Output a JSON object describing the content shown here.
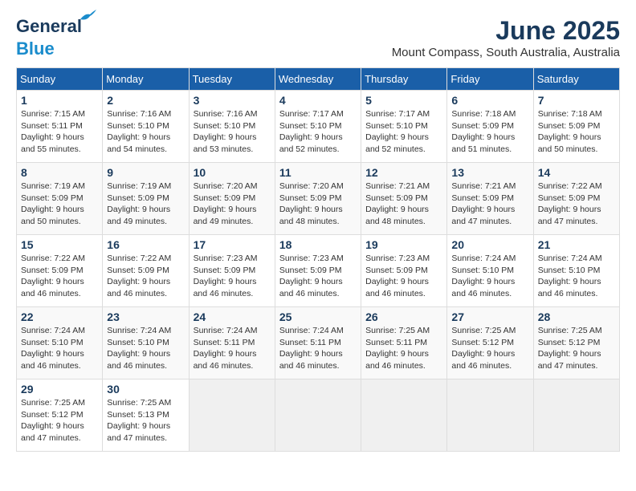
{
  "header": {
    "logo_line1": "General",
    "logo_line2": "Blue",
    "month": "June 2025",
    "location": "Mount Compass, South Australia, Australia"
  },
  "weekdays": [
    "Sunday",
    "Monday",
    "Tuesday",
    "Wednesday",
    "Thursday",
    "Friday",
    "Saturday"
  ],
  "weeks": [
    [
      {
        "day": "1",
        "sunrise": "7:15 AM",
        "sunset": "5:11 PM",
        "daylight": "9 hours and 55 minutes."
      },
      {
        "day": "2",
        "sunrise": "7:16 AM",
        "sunset": "5:10 PM",
        "daylight": "9 hours and 54 minutes."
      },
      {
        "day": "3",
        "sunrise": "7:16 AM",
        "sunset": "5:10 PM",
        "daylight": "9 hours and 53 minutes."
      },
      {
        "day": "4",
        "sunrise": "7:17 AM",
        "sunset": "5:10 PM",
        "daylight": "9 hours and 52 minutes."
      },
      {
        "day": "5",
        "sunrise": "7:17 AM",
        "sunset": "5:10 PM",
        "daylight": "9 hours and 52 minutes."
      },
      {
        "day": "6",
        "sunrise": "7:18 AM",
        "sunset": "5:09 PM",
        "daylight": "9 hours and 51 minutes."
      },
      {
        "day": "7",
        "sunrise": "7:18 AM",
        "sunset": "5:09 PM",
        "daylight": "9 hours and 50 minutes."
      }
    ],
    [
      {
        "day": "8",
        "sunrise": "7:19 AM",
        "sunset": "5:09 PM",
        "daylight": "9 hours and 50 minutes."
      },
      {
        "day": "9",
        "sunrise": "7:19 AM",
        "sunset": "5:09 PM",
        "daylight": "9 hours and 49 minutes."
      },
      {
        "day": "10",
        "sunrise": "7:20 AM",
        "sunset": "5:09 PM",
        "daylight": "9 hours and 49 minutes."
      },
      {
        "day": "11",
        "sunrise": "7:20 AM",
        "sunset": "5:09 PM",
        "daylight": "9 hours and 48 minutes."
      },
      {
        "day": "12",
        "sunrise": "7:21 AM",
        "sunset": "5:09 PM",
        "daylight": "9 hours and 48 minutes."
      },
      {
        "day": "13",
        "sunrise": "7:21 AM",
        "sunset": "5:09 PM",
        "daylight": "9 hours and 47 minutes."
      },
      {
        "day": "14",
        "sunrise": "7:22 AM",
        "sunset": "5:09 PM",
        "daylight": "9 hours and 47 minutes."
      }
    ],
    [
      {
        "day": "15",
        "sunrise": "7:22 AM",
        "sunset": "5:09 PM",
        "daylight": "9 hours and 46 minutes."
      },
      {
        "day": "16",
        "sunrise": "7:22 AM",
        "sunset": "5:09 PM",
        "daylight": "9 hours and 46 minutes."
      },
      {
        "day": "17",
        "sunrise": "7:23 AM",
        "sunset": "5:09 PM",
        "daylight": "9 hours and 46 minutes."
      },
      {
        "day": "18",
        "sunrise": "7:23 AM",
        "sunset": "5:09 PM",
        "daylight": "9 hours and 46 minutes."
      },
      {
        "day": "19",
        "sunrise": "7:23 AM",
        "sunset": "5:09 PM",
        "daylight": "9 hours and 46 minutes."
      },
      {
        "day": "20",
        "sunrise": "7:24 AM",
        "sunset": "5:10 PM",
        "daylight": "9 hours and 46 minutes."
      },
      {
        "day": "21",
        "sunrise": "7:24 AM",
        "sunset": "5:10 PM",
        "daylight": "9 hours and 46 minutes."
      }
    ],
    [
      {
        "day": "22",
        "sunrise": "7:24 AM",
        "sunset": "5:10 PM",
        "daylight": "9 hours and 46 minutes."
      },
      {
        "day": "23",
        "sunrise": "7:24 AM",
        "sunset": "5:10 PM",
        "daylight": "9 hours and 46 minutes."
      },
      {
        "day": "24",
        "sunrise": "7:24 AM",
        "sunset": "5:11 PM",
        "daylight": "9 hours and 46 minutes."
      },
      {
        "day": "25",
        "sunrise": "7:24 AM",
        "sunset": "5:11 PM",
        "daylight": "9 hours and 46 minutes."
      },
      {
        "day": "26",
        "sunrise": "7:25 AM",
        "sunset": "5:11 PM",
        "daylight": "9 hours and 46 minutes."
      },
      {
        "day": "27",
        "sunrise": "7:25 AM",
        "sunset": "5:12 PM",
        "daylight": "9 hours and 46 minutes."
      },
      {
        "day": "28",
        "sunrise": "7:25 AM",
        "sunset": "5:12 PM",
        "daylight": "9 hours and 47 minutes."
      }
    ],
    [
      {
        "day": "29",
        "sunrise": "7:25 AM",
        "sunset": "5:12 PM",
        "daylight": "9 hours and 47 minutes."
      },
      {
        "day": "30",
        "sunrise": "7:25 AM",
        "sunset": "5:13 PM",
        "daylight": "9 hours and 47 minutes."
      },
      null,
      null,
      null,
      null,
      null
    ]
  ],
  "labels": {
    "sunrise": "Sunrise:",
    "sunset": "Sunset:",
    "daylight": "Daylight:"
  }
}
